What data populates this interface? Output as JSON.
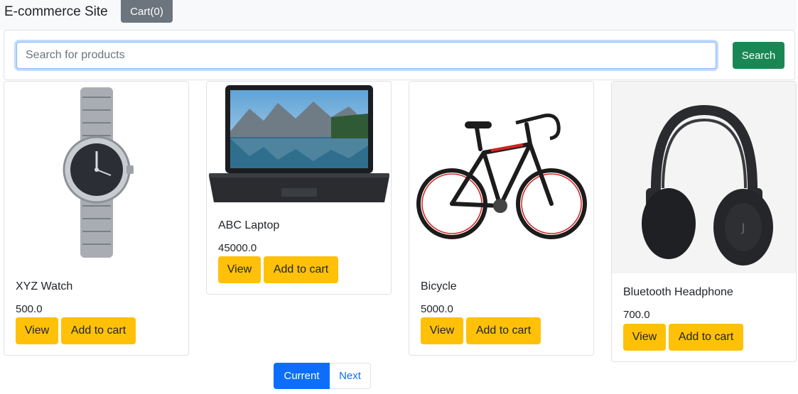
{
  "header": {
    "brand": "E-commerce Site",
    "cart_label": "Cart(0)"
  },
  "search": {
    "placeholder": "Search for products",
    "value": "",
    "button_label": "Search"
  },
  "products": [
    {
      "name": "XYZ Watch",
      "price": "500.0",
      "image": "watch",
      "view_label": "View",
      "add_label": "Add to cart"
    },
    {
      "name": "ABC Laptop",
      "price": "45000.0",
      "image": "laptop",
      "view_label": "View",
      "add_label": "Add to cart"
    },
    {
      "name": "Bicycle",
      "price": "5000.0",
      "image": "bicycle",
      "view_label": "View",
      "add_label": "Add to cart"
    },
    {
      "name": "Bluetooth Headphone",
      "price": "700.0",
      "image": "headphone",
      "view_label": "View",
      "add_label": "Add to cart"
    }
  ],
  "pagination": {
    "current_label": "Current",
    "next_label": "Next"
  },
  "colors": {
    "primary": "#0d6efd",
    "success": "#198754",
    "warning": "#ffc107",
    "secondary": "#6c757d"
  }
}
